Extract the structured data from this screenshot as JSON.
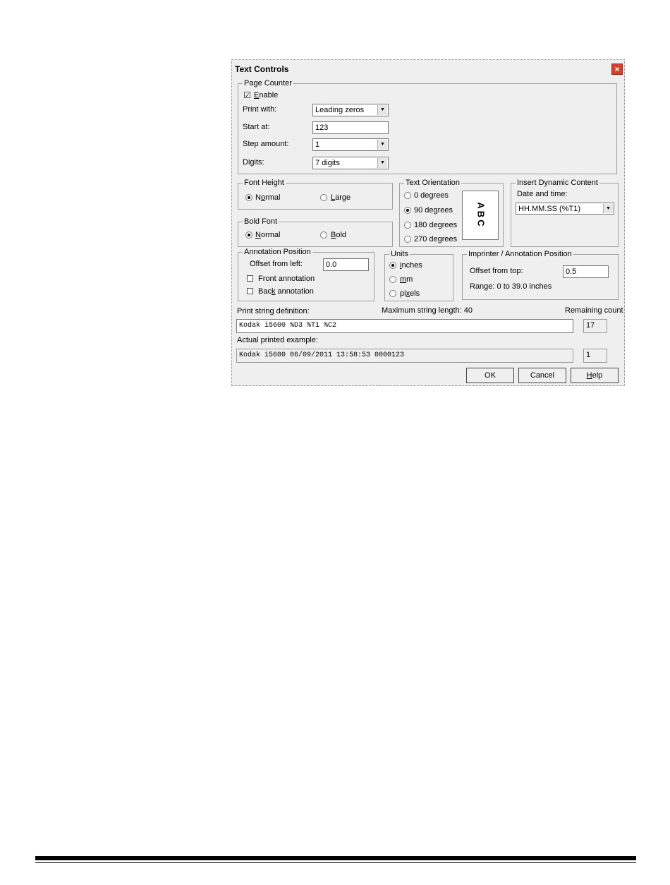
{
  "dialog": {
    "title": "Text Controls"
  },
  "page_counter": {
    "group_label": "Page Counter",
    "enable_label": "Enable",
    "enable_checked": true,
    "print_with_label": "Print with:",
    "print_with_value": "Leading zeros",
    "start_at_label": "Start at:",
    "start_at_value": "123",
    "step_amount_label": "Step amount:",
    "step_amount_value": "1",
    "digits_label": "Digits:",
    "digits_value": "7 digits"
  },
  "font_height": {
    "group_label": "Font Height",
    "normal": "Normal",
    "large": "Large",
    "selected": "Normal"
  },
  "bold_font": {
    "group_label": "Bold Font",
    "normal": "Normal",
    "bold": "Bold",
    "selected": "Normal"
  },
  "text_orientation": {
    "group_label": "Text Orientation",
    "options": [
      "0 degrees",
      "90 degrees",
      "180 degrees",
      "270 degrees"
    ],
    "selected": "90 degrees",
    "preview_text": "ABC"
  },
  "dynamic_content": {
    "group_label": "Insert Dynamic Content",
    "date_time_label": "Date and time:",
    "date_time_value": "HH.MM.SS (%T1)"
  },
  "annotation_position": {
    "group_label": "Annotation Position",
    "offset_label": "Offset from left:",
    "offset_value": "0.0",
    "front_label": "Front annotation",
    "back_label": "Back annotation"
  },
  "units": {
    "group_label": "Units",
    "inches": "inches",
    "mm": "mm",
    "pixels": "pixels",
    "selected": "inches"
  },
  "imprinter_position": {
    "group_label": "Imprinter / Annotation Position",
    "offset_top_label": "Offset from top:",
    "offset_top_value": "0.5",
    "range_text": "Range: 0 to 39.0 inches"
  },
  "print_string": {
    "definition_label": "Print string definition:",
    "max_length_label": "Maximum string length: 40",
    "remaining_label": "Remaining count",
    "definition_value": "Kodak i5600 %D3 %T1 %C2",
    "remaining_value": "17",
    "example_label": "Actual printed example:",
    "example_value": "Kodak i5600 06/09/2011 13:58:53 0000123",
    "example_count": "1"
  },
  "buttons": {
    "ok": "OK",
    "cancel": "Cancel",
    "help": "Help"
  }
}
